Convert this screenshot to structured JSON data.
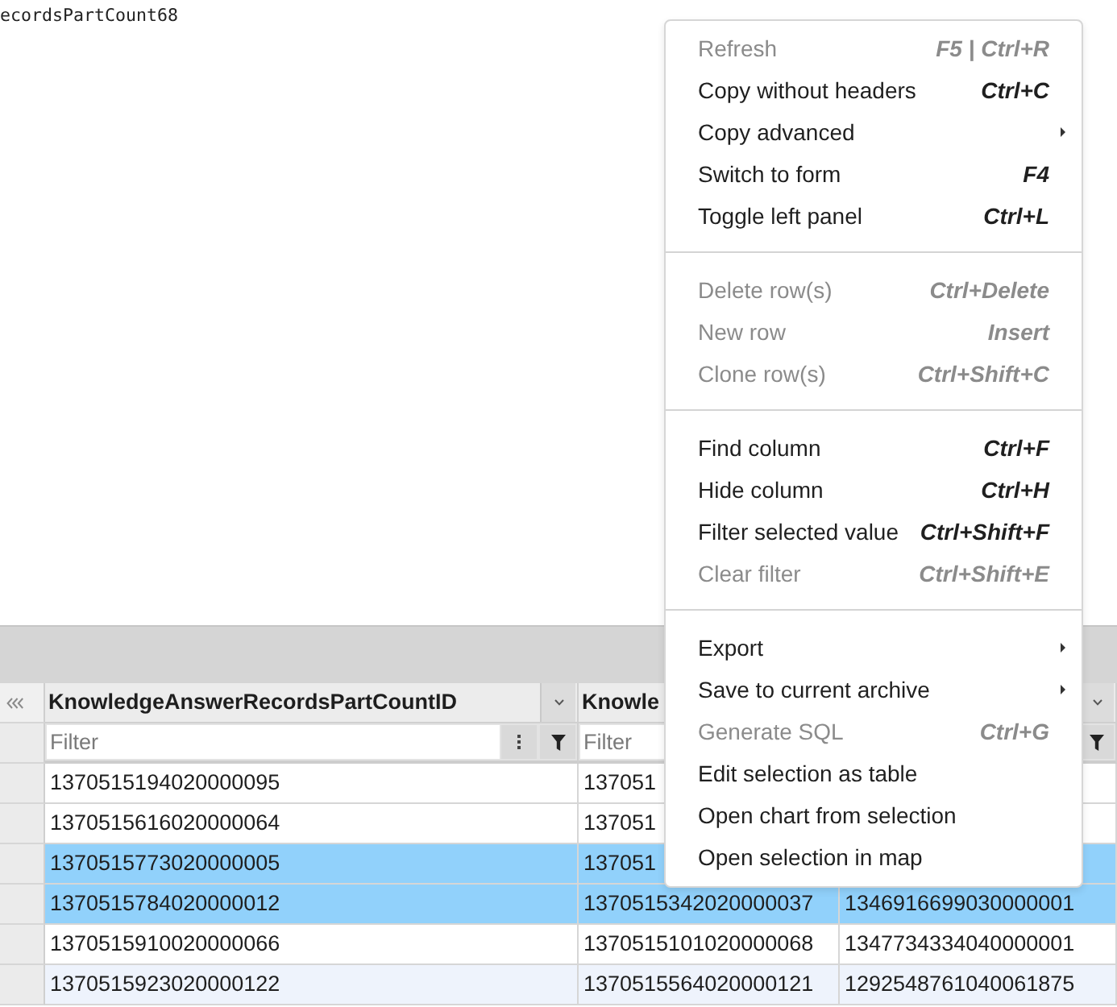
{
  "output_text": "ecordsPartCount68",
  "grid": {
    "columns": [
      {
        "title": "KnowledgeAnswerRecordsPartCountID",
        "menu_button": true,
        "filter_placeholder": "Filter",
        "options_button": true,
        "filter_button": true
      },
      {
        "title": "Knowle",
        "filter_placeholder": "Filter"
      },
      {
        "menu_button": true,
        "options_button": false,
        "filter_button": true
      }
    ],
    "rows": [
      {
        "selected": false,
        "hovered": false,
        "cells": [
          "1370515194020000095",
          "137051"
        ]
      },
      {
        "selected": false,
        "hovered": false,
        "cells": [
          "1370515616020000064",
          "137051"
        ]
      },
      {
        "selected": true,
        "hovered": false,
        "cells": [
          "1370515773020000005",
          "137051"
        ]
      },
      {
        "selected": true,
        "hovered": false,
        "cells": [
          "1370515784020000012",
          "1370515342020000037",
          "1346916699030000001"
        ]
      },
      {
        "selected": false,
        "hovered": false,
        "cells": [
          "1370515910020000066",
          "1370515101020000068",
          "1347734334040000001"
        ]
      },
      {
        "selected": false,
        "hovered": true,
        "cells": [
          "1370515923020000122",
          "1370515564020000121",
          "1292548761040061875"
        ]
      }
    ]
  },
  "context_menu": {
    "groups": [
      {
        "items": [
          {
            "label": "Refresh",
            "shortcut": "F5 | Ctrl+R",
            "disabled": true,
            "submenu": false
          },
          {
            "label": "Copy without headers",
            "shortcut": "Ctrl+C",
            "disabled": false,
            "submenu": false
          },
          {
            "label": "Copy advanced",
            "disabled": false,
            "submenu": true
          },
          {
            "label": "Switch to form",
            "shortcut": "F4",
            "disabled": false,
            "submenu": false
          },
          {
            "label": "Toggle left panel",
            "shortcut": "Ctrl+L",
            "disabled": false,
            "submenu": false
          }
        ]
      },
      {
        "items": [
          {
            "label": "Delete row(s)",
            "shortcut": "Ctrl+Delete",
            "disabled": true,
            "submenu": false
          },
          {
            "label": "New row",
            "shortcut": "Insert",
            "disabled": true,
            "submenu": false
          },
          {
            "label": "Clone row(s)",
            "shortcut": "Ctrl+Shift+C",
            "disabled": true,
            "submenu": false
          }
        ]
      },
      {
        "items": [
          {
            "label": "Find column",
            "shortcut": "Ctrl+F",
            "disabled": false,
            "submenu": false
          },
          {
            "label": "Hide column",
            "shortcut": "Ctrl+H",
            "disabled": false,
            "submenu": false
          },
          {
            "label": "Filter selected value",
            "shortcut": "Ctrl+Shift+F",
            "disabled": false,
            "submenu": false
          },
          {
            "label": "Clear filter",
            "shortcut": "Ctrl+Shift+E",
            "disabled": true,
            "submenu": false
          }
        ]
      },
      {
        "items": [
          {
            "label": "Export",
            "disabled": false,
            "submenu": true
          },
          {
            "label": "Save to current archive",
            "disabled": false,
            "submenu": true
          },
          {
            "label": "Generate SQL",
            "shortcut": "Ctrl+G",
            "disabled": true,
            "submenu": false
          },
          {
            "label": "Edit selection as table",
            "disabled": false,
            "submenu": false
          },
          {
            "label": "Open chart from selection",
            "disabled": false,
            "submenu": false
          },
          {
            "label": "Open selection in map",
            "disabled": false,
            "submenu": false
          }
        ]
      }
    ]
  }
}
